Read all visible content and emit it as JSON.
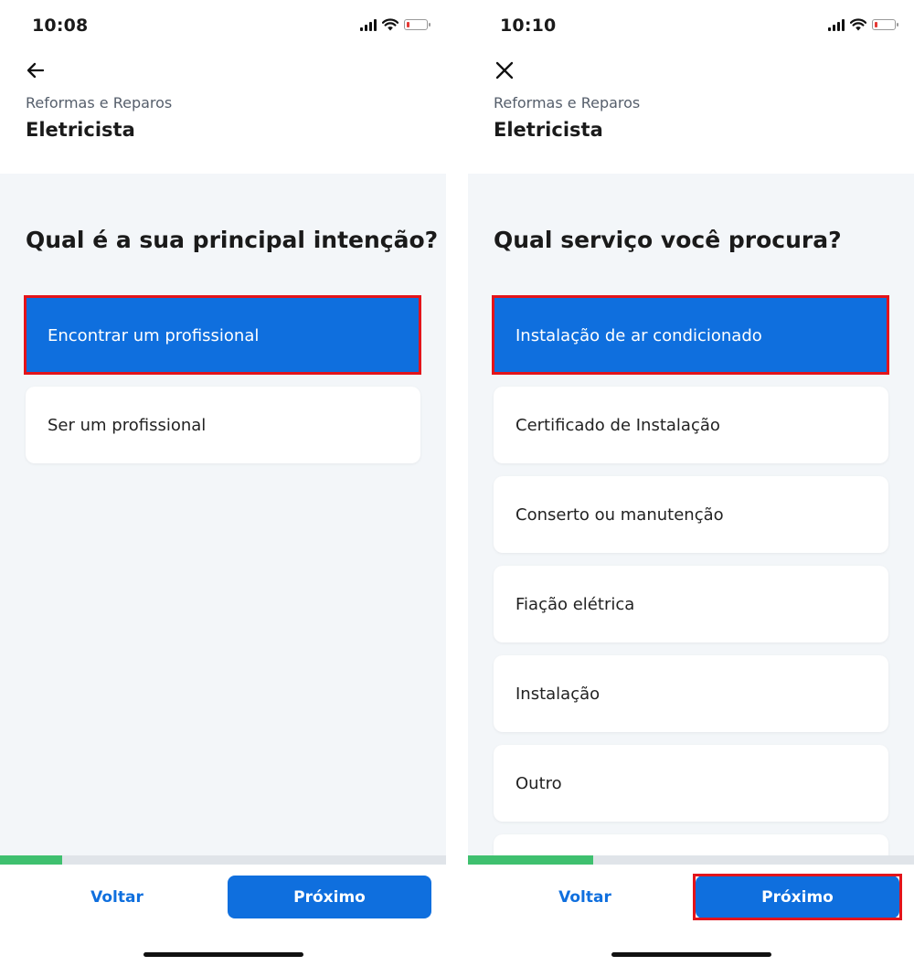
{
  "screens": [
    {
      "status": {
        "time": "10:08",
        "battery_level": 0.12
      },
      "nav_icon": "back-arrow-icon",
      "breadcrumb": "Reformas e Reparos",
      "title": "Eletricista",
      "question": "Qual é a sua principal intenção?",
      "options": [
        "Encontrar um profissional",
        "Ser um profissional"
      ],
      "selected_option": "Encontrar um profissional",
      "progress": 0.14,
      "footer": {
        "back_label": "Voltar",
        "next_label": "Próximo"
      }
    },
    {
      "status": {
        "time": "10:10",
        "battery_level": 0.12
      },
      "nav_icon": "close-icon",
      "breadcrumb": "Reformas e Reparos",
      "title": "Eletricista",
      "question": "Qual serviço você procura?",
      "options": [
        "Instalação de ar condicionado",
        "Certificado de Instalação",
        "Conserto ou manutenção",
        "Fiação elétrica",
        "Instalação",
        "Outro"
      ],
      "selected_option": "Instalação de ar condicionado",
      "progress": 0.28,
      "footer": {
        "back_label": "Voltar",
        "next_label": "Próximo"
      }
    }
  ],
  "colors": {
    "accent": "#0f6fde",
    "highlight": "#e3141b",
    "progress": "#3fc06f",
    "background": "#f3f6f9"
  }
}
